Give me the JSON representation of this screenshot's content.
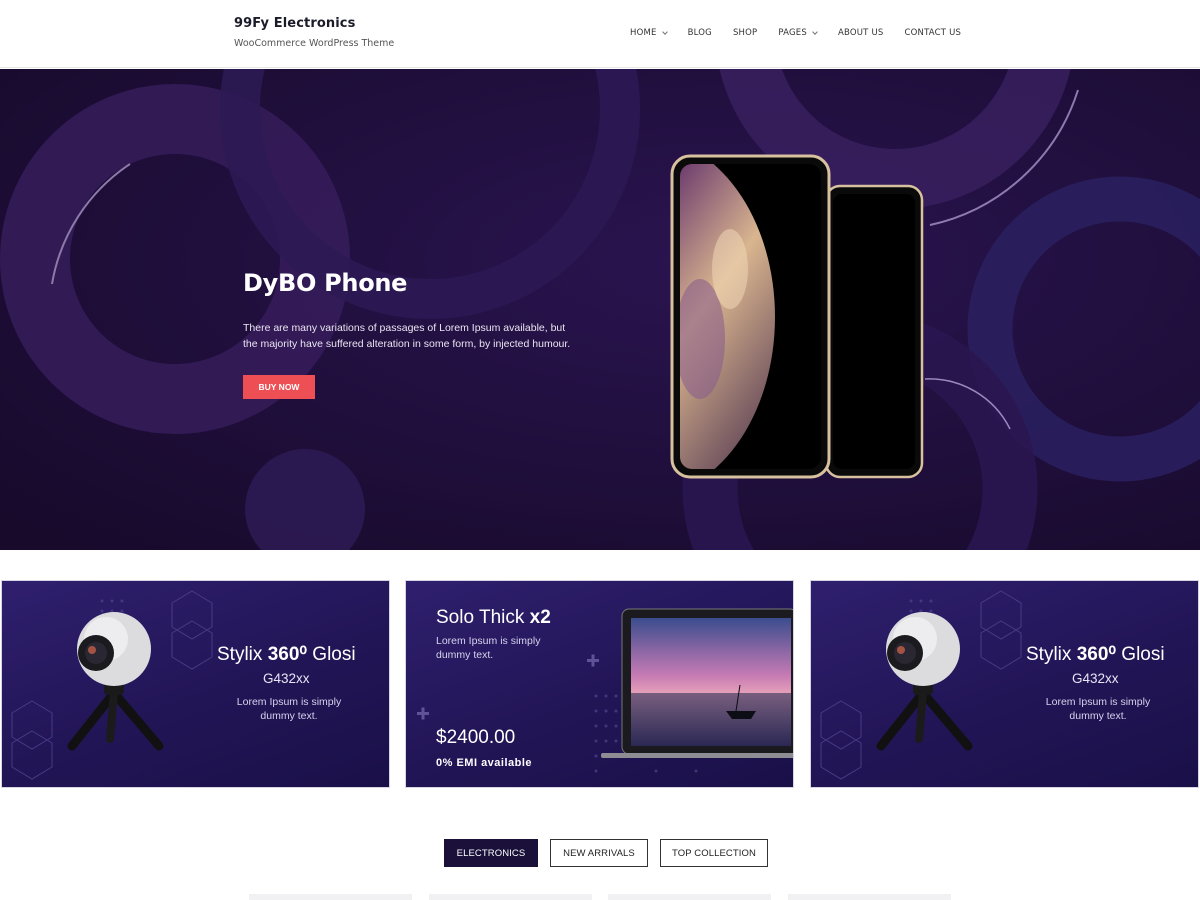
{
  "header": {
    "brand_title": "99Fy Electronics",
    "brand_tagline": "WooCommerce WordPress Theme",
    "nav": [
      {
        "label": "HOME",
        "dropdown": true
      },
      {
        "label": "BLOG",
        "dropdown": false
      },
      {
        "label": "SHOP",
        "dropdown": false
      },
      {
        "label": "PAGES",
        "dropdown": true
      },
      {
        "label": "ABOUT US",
        "dropdown": false
      },
      {
        "label": "CONTACT US",
        "dropdown": false
      }
    ]
  },
  "hero": {
    "title": "DyBO Phone",
    "text": "There are many variations of passages of Lorem Ipsum available, but the majority have suffered alteration in some form, by injected humour.",
    "button": "BUY NOW",
    "button_color": "#ee4f55",
    "background_color": "#1c0d33"
  },
  "promos": [
    {
      "title_pre": "Stylix ",
      "title_bold": "360⁰",
      "title_post": " Glosi",
      "subtitle": "G432xx",
      "desc": "Lorem Ipsum is simply dummy text."
    },
    {
      "title_pre": "Solo Thick ",
      "title_bold": "x2",
      "desc": "Lorem Ipsum is simply dummy text.",
      "price": "$2400.00",
      "emi": "0% EMI available"
    },
    {
      "title_pre": "Stylix ",
      "title_bold": "360⁰",
      "title_post": " Glosi",
      "subtitle": "G432xx",
      "desc": "Lorem Ipsum is simply dummy text."
    }
  ],
  "tabs": [
    {
      "label": "ELECTRONICS",
      "active": true
    },
    {
      "label": "NEW ARRIVALS",
      "active": false
    },
    {
      "label": "TOP COLLECTION",
      "active": false
    }
  ]
}
